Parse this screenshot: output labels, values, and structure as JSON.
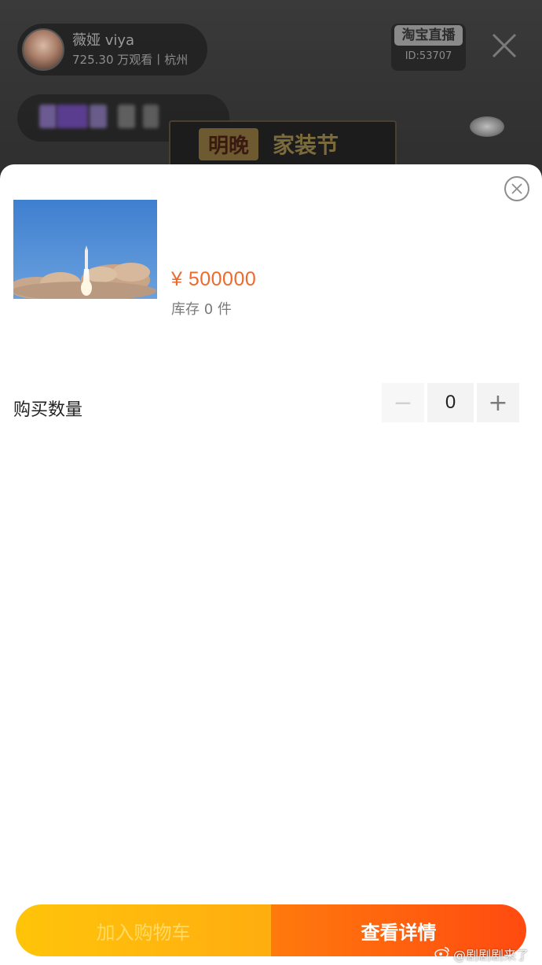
{
  "stream": {
    "host_name": "薇娅 viya",
    "host_meta": "725.30 万观看丨杭州",
    "platform_badge": "淘宝直播",
    "room_id": "ID:53707",
    "banner_left": "明晚",
    "banner_right": "家装节"
  },
  "sheet": {
    "price": "¥ 500000",
    "stock": "库存 0 件",
    "quantity_label": "购买数量",
    "quantity_value": "0",
    "minus_glyph": "−",
    "plus_glyph": "+"
  },
  "actions": {
    "add_to_cart": "加入购物车",
    "view_details": "查看详情"
  },
  "watermark": "@剧剧剧来了",
  "icons": {
    "stream_close": "close-icon",
    "sheet_close": "close-circle-icon",
    "watermark": "weibo-icon"
  },
  "colors": {
    "price": "#ee6a2c",
    "add_to_cart_bg": "#ffc40a",
    "view_details_bg": "#ff5a10"
  }
}
